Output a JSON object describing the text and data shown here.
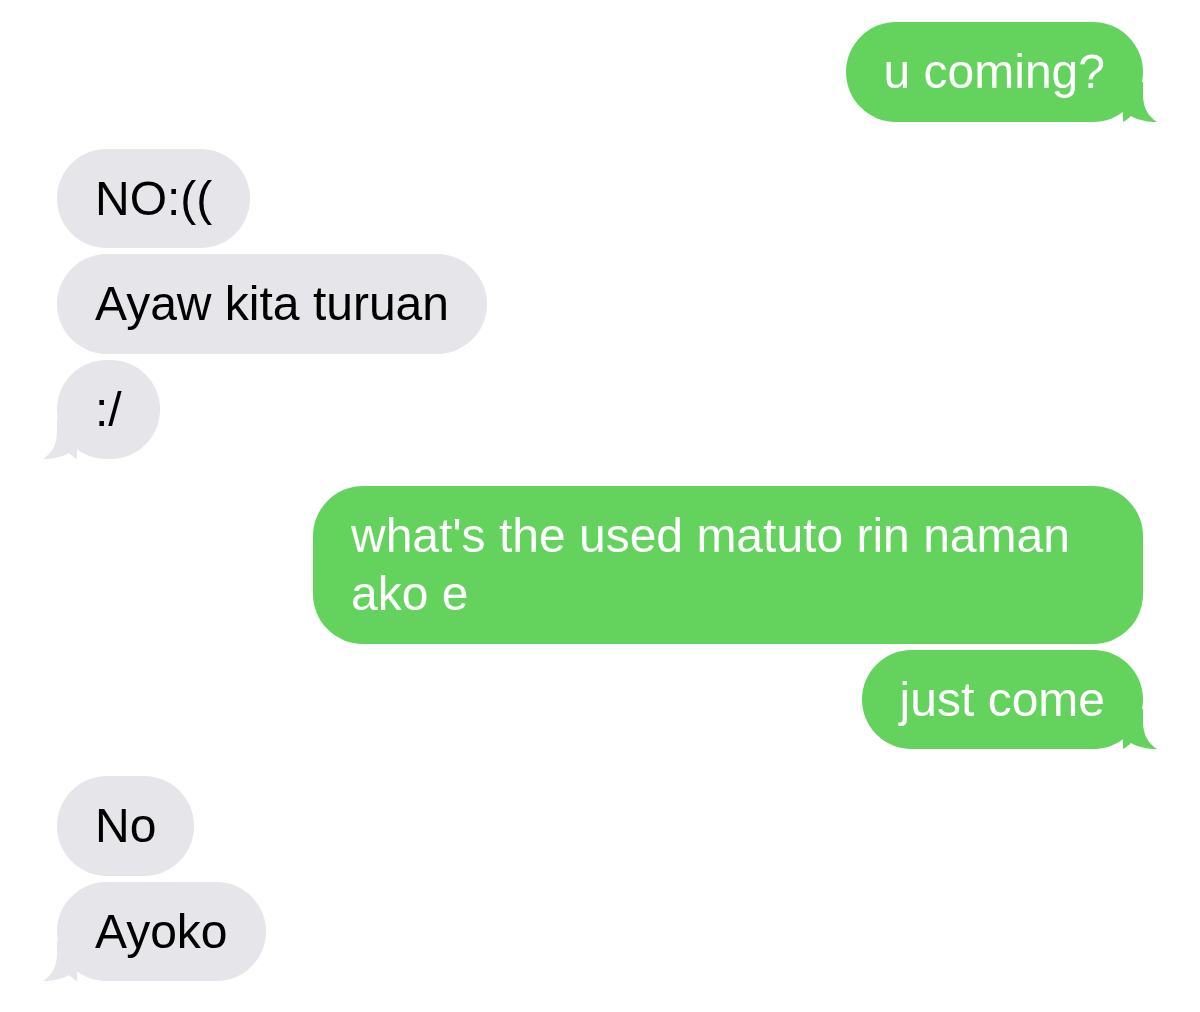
{
  "messages": [
    {
      "kind": "sent",
      "text": "u coming?"
    },
    {
      "kind": "received",
      "text": "NO:(("
    },
    {
      "kind": "received",
      "text": "Ayaw kita turuan"
    },
    {
      "kind": "received",
      "text": ":/"
    },
    {
      "kind": "sent",
      "text": "what's the used matuto rin naman ako e"
    },
    {
      "kind": "sent",
      "text": "just come"
    },
    {
      "kind": "received",
      "text": "No"
    },
    {
      "kind": "received",
      "text": "Ayoko"
    }
  ]
}
